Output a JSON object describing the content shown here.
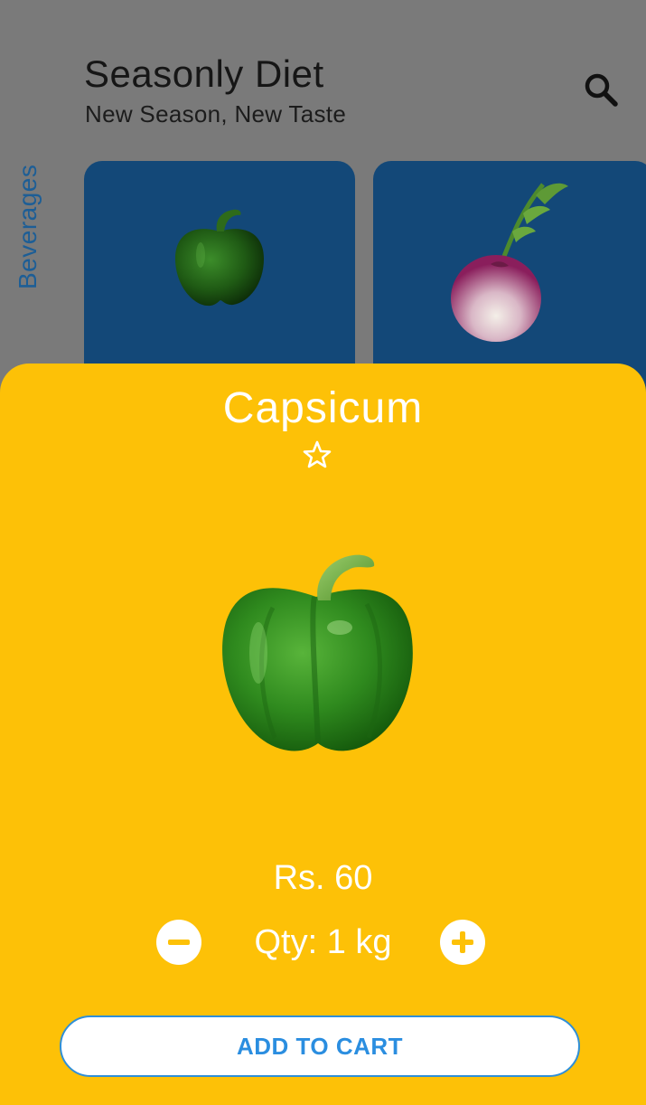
{
  "header": {
    "title": "Seasonly Diet",
    "subtitle": "New Season, New Taste",
    "search_icon": "search-icon"
  },
  "sidebar": {
    "category_label": "Beverages"
  },
  "cards": [
    {
      "item": "capsicum",
      "image_icon": "capsicum-image"
    },
    {
      "item": "turnip",
      "image_icon": "turnip-image"
    }
  ],
  "detail": {
    "name": "Capsicum",
    "favorite_icon": "star-outline-icon",
    "price": "Rs. 60",
    "qty_prefix": "Qty: ",
    "qty_value": "1 kg",
    "decrease_icon": "minus-icon",
    "increase_icon": "plus-icon",
    "cta_label": "ADD TO CART"
  },
  "colors": {
    "sheet_background": "#fdc107",
    "card_background": "#134878",
    "accent": "#2b8ee0",
    "scrim": "#7a7a7a"
  }
}
